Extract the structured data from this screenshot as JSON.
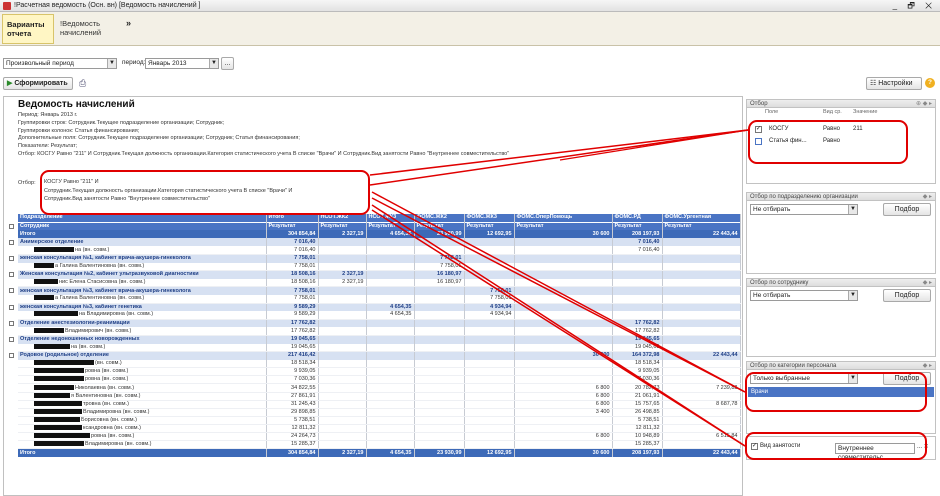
{
  "window": {
    "title": "!Расчетная ведомость (Осн. вн) [Ведомость начислений ]",
    "controls": "_ 🗗 ✕"
  },
  "toolbar": {
    "tab_variants": "Варианты отчета",
    "tab_report": "!Ведомость начислений",
    "more": "»"
  },
  "period": {
    "type": "Произвольный период",
    "label": "период:",
    "value": "Январь 2013",
    "ellipsis": "..."
  },
  "actions": {
    "generate": "Сформировать",
    "settings": "Настройки",
    "help": "?"
  },
  "report": {
    "title": "Ведомость начислений",
    "lines": [
      "Период: Январь 2013 г.",
      "Группировки строк: Сотрудник.Текущее подразделение организации; Сотрудник;",
      "Группировки колонок: Статья финансирования;",
      "Дополнительные поля: Сотрудник.Текущее подразделение организации; Сотрудник; Статья финансирования;",
      "Показатели: Результат;",
      "Отбор: КОСГУ Равно \"211\" И Сотрудник.Текущая должность организации.Категория статистического учета В списке \"Врачи\" И Сотрудник.Вид занятости Равно \"Внутреннее совместительство\""
    ],
    "filter_label": "Отбор:",
    "filter_lines": [
      "КОСГУ Равно \"211\" И",
      "Сотрудник.Текущая должность организации.Категория статистического учета В списке \"Врачи\" И",
      "Сотрудник.Вид занятости Равно \"Внутреннее совместительство\""
    ]
  },
  "grid": {
    "columns": [
      "Подразделение",
      "Итого",
      "НСОТ.ЖК2",
      "НСОТ.ЖК3",
      "ФОМС.ЖК2",
      "ФОМС.ЖК3",
      "ФОМС.ОперПомощь",
      "ФОМС.РД",
      "ФОМС.Ургентная"
    ],
    "subheader": [
      "Сотрудник",
      "Результат",
      "Результат",
      "Результат",
      "Результат",
      "Результат",
      "Результат",
      "Результат",
      "Результат"
    ],
    "rows": [
      {
        "kind": "tot",
        "cells": [
          "Итого",
          "304 854,84",
          "2 327,19",
          "4 654,35",
          "23 930,99",
          "12 692,95",
          "30 600",
          "208 197,93",
          "22 443,44"
        ]
      },
      {
        "kind": "grp",
        "cells": [
          "Анимерское отделение",
          "7 016,40",
          "",
          "",
          "",
          "",
          "",
          "7 016,40",
          ""
        ]
      },
      {
        "kind": "emp",
        "r": 40,
        "cells": [
          "на (вн. совм.)",
          "7 016,40",
          "",
          "",
          "",
          "",
          "",
          "7 016,40",
          ""
        ]
      },
      {
        "kind": "grp",
        "cells": [
          "женская консультация №1, кабинет врача-акушера-гинеколога",
          "7 758,01",
          "",
          "",
          "7 758,01",
          "",
          "",
          "",
          ""
        ]
      },
      {
        "kind": "emp",
        "r": 20,
        "cells": [
          "а Галина Валентиновна (вн. совм.)",
          "7 758,01",
          "",
          "",
          "7 758,01",
          "",
          "",
          "",
          ""
        ]
      },
      {
        "kind": "grp",
        "cells": [
          "Женская консультация №2, кабинет ультразвуковой диагностики",
          "18 508,16",
          "2 327,19",
          "",
          "16 180,97",
          "",
          "",
          "",
          ""
        ]
      },
      {
        "kind": "emp",
        "r": 24,
        "cells": [
          "нис Елена Стасисовна (вн. совм.)",
          "18 508,16",
          "2 327,19",
          "",
          "16 180,97",
          "",
          "",
          "",
          ""
        ]
      },
      {
        "kind": "grp",
        "cells": [
          "женская консультация №3, кабинет врача-акушера-гинеколога",
          "7 758,01",
          "",
          "",
          "",
          "7 758,01",
          "",
          "",
          ""
        ]
      },
      {
        "kind": "emp",
        "r": 20,
        "cells": [
          "а Галина Валентиновна (вн. совм.)",
          "7 758,01",
          "",
          "",
          "",
          "7 758,01",
          "",
          "",
          ""
        ]
      },
      {
        "kind": "grp",
        "cells": [
          "женская консультация №3, кабинет генетика",
          "9 589,29",
          "",
          "4 654,35",
          "",
          "4 934,94",
          "",
          "",
          ""
        ]
      },
      {
        "kind": "emp",
        "r": 44,
        "cells": [
          "на Владимировна (вн. совм.)",
          "9 589,29",
          "",
          "4 654,35",
          "",
          "4 934,94",
          "",
          "",
          ""
        ]
      },
      {
        "kind": "grp",
        "cells": [
          "Отделение анестезиологии-реанимации",
          "17 762,82",
          "",
          "",
          "",
          "",
          "",
          "17 762,82",
          ""
        ]
      },
      {
        "kind": "emp",
        "r": 30,
        "cells": [
          "Владимирович (вн. совм.)",
          "17 762,82",
          "",
          "",
          "",
          "",
          "",
          "17 762,82",
          ""
        ]
      },
      {
        "kind": "grp",
        "cells": [
          "Отделение недоношенных новорожденных",
          "19 045,65",
          "",
          "",
          "",
          "",
          "",
          "19 045,65",
          ""
        ]
      },
      {
        "kind": "emp",
        "r": 36,
        "cells": [
          "на (вн. совм.)",
          "19 045,65",
          "",
          "",
          "",
          "",
          "",
          "19 045,65",
          ""
        ]
      },
      {
        "kind": "grp",
        "cells": [
          "Родовое (родильное) отделение",
          "217 416,42",
          "",
          "",
          "",
          "",
          "30 600",
          "164 372,98",
          "22 443,44"
        ]
      },
      {
        "kind": "emp",
        "r": 60,
        "cells": [
          "(вн. совм.)",
          "18 518,34",
          "",
          "",
          "",
          "",
          "",
          "18 518,34",
          ""
        ]
      },
      {
        "kind": "emp",
        "r": 50,
        "cells": [
          "ровна (вн. совм.)",
          "9 939,05",
          "",
          "",
          "",
          "",
          "",
          "9 939,05",
          ""
        ]
      },
      {
        "kind": "emp",
        "r": 50,
        "cells": [
          "ровна (вн. совм.)",
          "7 030,36",
          "",
          "",
          "",
          "",
          "",
          "7 030,36",
          ""
        ]
      },
      {
        "kind": "emp",
        "r": 40,
        "cells": [
          "Николаевна (вн. совм.)",
          "34 822,55",
          "",
          "",
          "",
          "",
          "6 800",
          "20 782,73",
          "7 239,82"
        ]
      },
      {
        "kind": "emp",
        "r": 36,
        "cells": [
          "я Валентиновна (вн. совм.)",
          "27 861,91",
          "",
          "",
          "",
          "",
          "6 800",
          "21 061,91",
          ""
        ]
      },
      {
        "kind": "emp",
        "r": 48,
        "cells": [
          "тровна (вн. совм.)",
          "31 245,43",
          "",
          "",
          "",
          "",
          "6 800",
          "15 757,65",
          "8 687,78"
        ]
      },
      {
        "kind": "emp",
        "r": 48,
        "cells": [
          "Владимировна (вн. совм.)",
          "29 898,85",
          "",
          "",
          "",
          "",
          "3 400",
          "26 498,85",
          ""
        ]
      },
      {
        "kind": "emp",
        "r": 46,
        "cells": [
          "Борисовна (вн. совм.)",
          "5 738,51",
          "",
          "",
          "",
          "",
          "",
          "5 738,51",
          ""
        ]
      },
      {
        "kind": "emp",
        "r": 48,
        "cells": [
          "ксандровна (вн. совм.)",
          "12 811,32",
          "",
          "",
          "",
          "",
          "",
          "12 811,32",
          ""
        ]
      },
      {
        "kind": "emp",
        "r": 56,
        "cells": [
          "ровна (вн. совм.)",
          "24 264,73",
          "",
          "",
          "",
          "",
          "6 800",
          "10 948,89",
          "6 515,84"
        ]
      },
      {
        "kind": "emp",
        "r": 50,
        "cells": [
          "Владимировна (вн. совм.)",
          "15 285,37",
          "",
          "",
          "",
          "",
          "",
          "15 285,37",
          ""
        ]
      },
      {
        "kind": "tot",
        "cells": [
          "Итого",
          "304 854,84",
          "2 327,19",
          "4 654,35",
          "23 930,99",
          "12 692,95",
          "30 600",
          "208 197,93",
          "22 443,44"
        ]
      }
    ]
  },
  "panel": {
    "filter_title": "Отбор",
    "filter_cols": [
      "Поле",
      "Вид ср.",
      "Значение"
    ],
    "filter_rows": [
      {
        "field": "КОСГУ",
        "cmp": "Равно",
        "value": "211"
      },
      {
        "field": "Статья фин...",
        "cmp": "Равно",
        "value": ""
      }
    ],
    "dept_title": "Отбор по подразделению организации",
    "dept_select": "Не отбирать",
    "dept_btn": "Подбор",
    "emp_title": "Отбор по сотруднику",
    "emp_select": "Не отбирать",
    "emp_btn": "Подбор",
    "cat_title": "Отбор по категории персонала",
    "cat_select": "Только выбранные",
    "cat_btn": "Подбор",
    "cat_item": "Врачи",
    "employment_label": "Вид занятости",
    "employment_value": "Внутреннее совместительс",
    "employment_btns": "... ✕"
  }
}
